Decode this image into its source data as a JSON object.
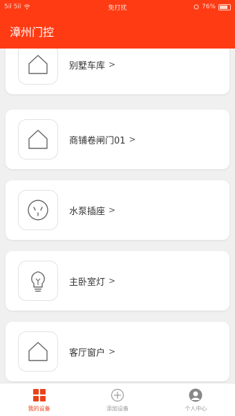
{
  "status_bar": {
    "left_text": "5il 5il",
    "center_text": "免打扰",
    "battery_text": "76%"
  },
  "header": {
    "title": "漳州门控"
  },
  "devices": [
    {
      "label": "别墅车库",
      "icon": "house-icon"
    },
    {
      "label": "商铺卷闸门01",
      "icon": "house-icon"
    },
    {
      "label": "水泵插座",
      "icon": "socket-icon"
    },
    {
      "label": "主卧室灯",
      "icon": "bulb-icon"
    },
    {
      "label": "客厅窗户",
      "icon": "house-icon"
    }
  ],
  "chevron": ">",
  "tabs": [
    {
      "label": "我的设备",
      "icon": "grid-icon",
      "active": true
    },
    {
      "label": "添加设备",
      "icon": "plus-circle-icon",
      "active": false
    },
    {
      "label": "个人中心",
      "icon": "user-avatar-icon",
      "active": false
    }
  ],
  "colors": {
    "brand": "#ff3b14",
    "tab_active": "#e8431c"
  }
}
